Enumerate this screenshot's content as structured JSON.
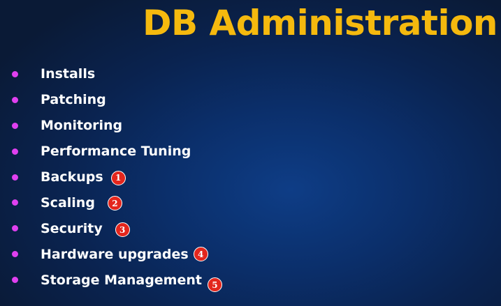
{
  "title": "DB Administration",
  "items": [
    {
      "label": "Installs",
      "badge": ""
    },
    {
      "label": "Patching",
      "badge": ""
    },
    {
      "label": "Monitoring",
      "badge": ""
    },
    {
      "label": "Performance Tuning",
      "badge": ""
    },
    {
      "label": "Backups",
      "badge": "1"
    },
    {
      "label": "Scaling",
      "badge": "2"
    },
    {
      "label": "Security",
      "badge": "3"
    },
    {
      "label": "Hardware upgrades",
      "badge": "4"
    },
    {
      "label": "Storage Management",
      "badge": "5"
    }
  ],
  "colors": {
    "title": "#f5b90e",
    "bullet": "#e040f0",
    "badge": "#e3261d",
    "background": "#0b2f6b"
  }
}
